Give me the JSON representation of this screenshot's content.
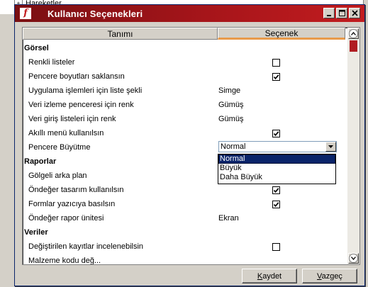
{
  "background": {
    "tree_item": "Hareketler"
  },
  "dialog": {
    "title": "Kullanıcı Seçenekleri",
    "icon_letter": "f",
    "title_buttons": [
      "minimize",
      "maximize",
      "close"
    ]
  },
  "grid": {
    "columns": [
      "Tanımı",
      "Seçenek"
    ],
    "rows": [
      {
        "type": "section",
        "label": "Görsel"
      },
      {
        "type": "check",
        "label": "Renkli listeler",
        "checked": false
      },
      {
        "type": "check",
        "label": "Pencere boyutları saklansın",
        "checked": true
      },
      {
        "type": "text",
        "label": "Uygulama işlemleri için liste şekli",
        "value": "Simge"
      },
      {
        "type": "text",
        "label": "Veri izleme penceresi için renk",
        "value": "Gümüş"
      },
      {
        "type": "text",
        "label": "Veri giriş listeleri için renk",
        "value": "Gümüş"
      },
      {
        "type": "check",
        "label": "Akıllı menü kullanılsın",
        "checked": true
      },
      {
        "type": "dropdown",
        "label": "Pencere Büyütme",
        "value": "Normal"
      },
      {
        "type": "section",
        "label": "Raporlar"
      },
      {
        "type": "text",
        "label": "Gölgeli arka plan",
        "value": ""
      },
      {
        "type": "check",
        "label": "Öndeğer tasarım kullanılsın",
        "checked": true
      },
      {
        "type": "check",
        "label": "Formlar yazıcıya basılsın",
        "checked": true
      },
      {
        "type": "text",
        "label": "Öndeğer rapor ünitesi",
        "value": "Ekran"
      },
      {
        "type": "section",
        "label": "Veriler"
      },
      {
        "type": "check",
        "label": "Değiştirilen kayıtlar incelenebilsin",
        "checked": false
      },
      {
        "type": "text",
        "label": "Malzeme kodu değ...",
        "value": ""
      }
    ],
    "dropdown_options": [
      "Normal",
      "Büyük",
      "Daha Büyük"
    ],
    "dropdown_selected": "Normal"
  },
  "buttons": {
    "save_underline": "K",
    "save_rest": "aydet",
    "cancel_underline": "V",
    "cancel_rest": "azgeç"
  },
  "colors": {
    "titlebar": "#a6151a",
    "selection": "#0a246a",
    "header_accent": "#e89a4a"
  }
}
